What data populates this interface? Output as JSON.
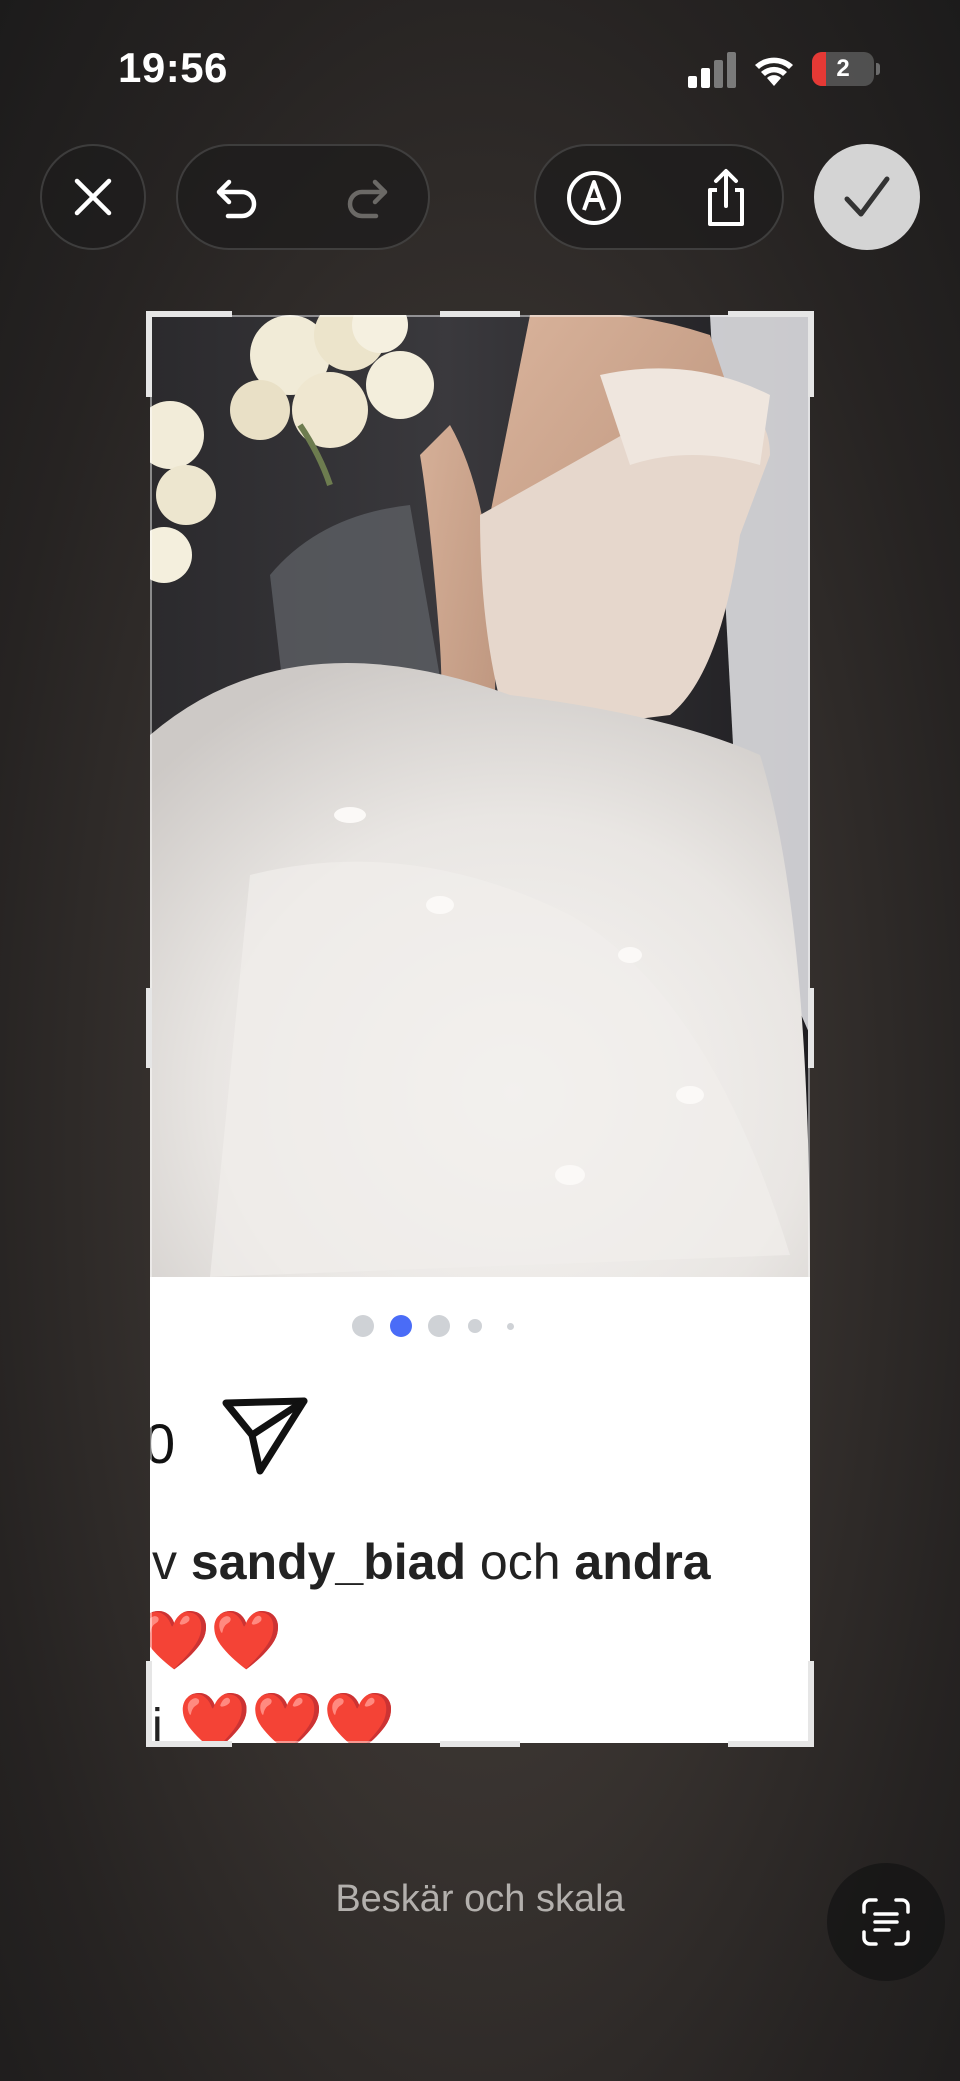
{
  "status_bar": {
    "time": "19:56",
    "battery_level": "2",
    "battery_color": "#e53935",
    "icons": [
      "cellular-signal-icon",
      "wifi-icon",
      "battery-icon"
    ]
  },
  "toolbar": {
    "close_icon": "close-icon",
    "undo_icon": "undo-icon",
    "redo_icon": "redo-icon",
    "markup_icon": "markup-pen-icon",
    "share_icon": "share-icon",
    "done_icon": "checkmark-icon"
  },
  "screenshot_content": {
    "page_indicator": {
      "count": 5,
      "active_index": 1
    },
    "count_fragment": "0",
    "likes_prefix": "v ",
    "likes_user": "sandy_biad",
    "likes_middle": " och ",
    "likes_others": "andra",
    "emoji_line_1": "❤️❤️",
    "comment_fragment": "i",
    "emoji_line_2": "❤️❤️❤️"
  },
  "bottom": {
    "caption": "Beskär och skala",
    "scan_icon": "live-text-scan-icon"
  },
  "colors": {
    "accent_dot": "#4a6cf7",
    "done_button": "#d4d4d4"
  }
}
